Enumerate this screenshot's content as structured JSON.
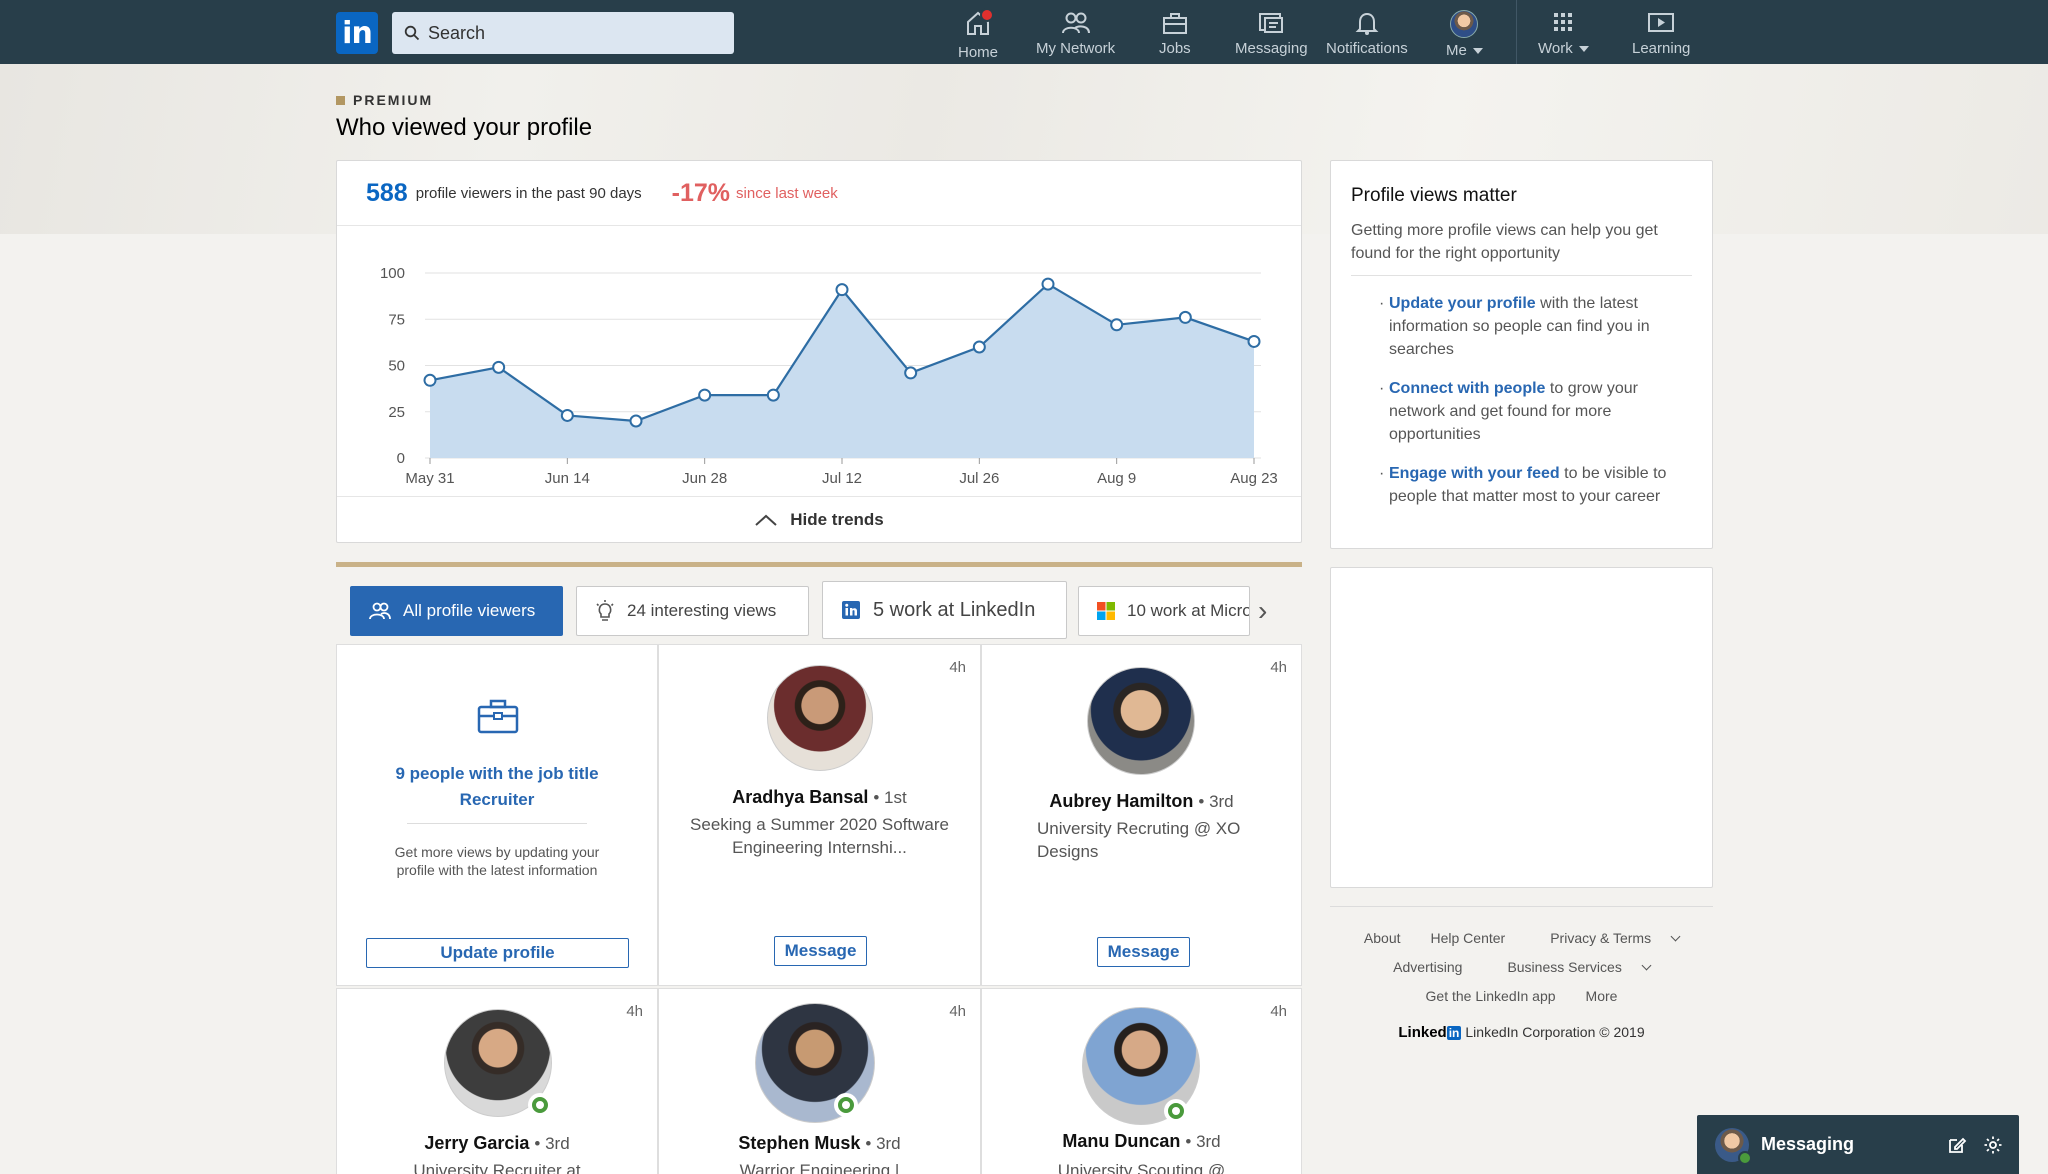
{
  "nav": {
    "logo": "in",
    "search_placeholder": "Search",
    "items": [
      {
        "label": "Home",
        "icon": "home-icon"
      },
      {
        "label": "My Network",
        "icon": "network-icon"
      },
      {
        "label": "Jobs",
        "icon": "briefcase-icon"
      },
      {
        "label": "Messaging",
        "icon": "messaging-icon"
      },
      {
        "label": "Notifications",
        "icon": "bell-icon"
      },
      {
        "label": "Me",
        "icon": "avatar"
      },
      {
        "label": "Work",
        "icon": "grid-icon"
      },
      {
        "label": "Learning",
        "icon": "play-icon"
      }
    ]
  },
  "header": {
    "premium": "PREMIUM",
    "title": "Who viewed your profile"
  },
  "stats": {
    "viewers_count": "588",
    "viewers_text": "profile viewers in the past 90 days",
    "change": "-17%",
    "change_text": "since last week"
  },
  "chart_data": {
    "type": "area",
    "x": [
      "May 31",
      "Jun 7",
      "Jun 14",
      "Jun 21",
      "Jun 28",
      "Jul 5",
      "Jul 12",
      "Jul 19",
      "Jul 26",
      "Aug 2",
      "Aug 9",
      "Aug 16",
      "Aug 23"
    ],
    "values": [
      42,
      49,
      23,
      20,
      34,
      34,
      91,
      46,
      60,
      94,
      72,
      76,
      63
    ],
    "x_tick_labels": [
      "May 31",
      "Jun 14",
      "Jun 28",
      "Jul 12",
      "Jul 26",
      "Aug 9",
      "Aug 23"
    ],
    "y_ticks": [
      0,
      25,
      50,
      75,
      100
    ],
    "ylim": [
      0,
      100
    ],
    "grid": true,
    "color": "#2e6da4",
    "fill": "#c8dcef"
  },
  "trends_label": "Hide trends",
  "tabs": [
    {
      "label": "All profile viewers",
      "icon": "people-icon",
      "active": true
    },
    {
      "label": "24 interesting views",
      "icon": "lightbulb-icon"
    },
    {
      "label": "5 work at LinkedIn",
      "icon": "linkedin-icon"
    },
    {
      "label": "10 work at Micro",
      "icon": "microsoft-icon"
    }
  ],
  "job_card": {
    "title": "9 people with the job title Recruiter",
    "desc": "Get more views by updating your profile with the latest information",
    "button": "Update profile"
  },
  "viewers": [
    {
      "name": "Aradhya Bansal",
      "degree": "• 1st",
      "headline": "Seeking a Summer 2020 Software Engineering Internshi...",
      "time": "4h",
      "button": "Message"
    },
    {
      "name": "Aubrey Hamilton",
      "degree": "• 3rd",
      "headline": "University Recruting @ XO Designs",
      "time": "4h",
      "button": "Message"
    },
    {
      "name": "Jerry Garcia",
      "degree": "• 3rd",
      "headline": "University Recruiter at",
      "time": "4h"
    },
    {
      "name": "Stephen Musk",
      "degree": "• 3rd",
      "headline": "Warrior Engineering |",
      "time": "4h"
    },
    {
      "name": "Manu Duncan",
      "degree": "• 3rd",
      "headline": "University Scouting @",
      "time": "4h"
    }
  ],
  "tips": {
    "title": "Profile views matter",
    "subtitle": "Getting more profile views can help you get found for the right opportunity",
    "items": [
      {
        "link": "Update your profile",
        "text": " with the latest information so people can find you in searches"
      },
      {
        "link": "Connect with people",
        "text": " to grow your network and get found for more opportunities"
      },
      {
        "link": "Engage with your feed",
        "text": " to be visible to people that matter most to your career"
      }
    ]
  },
  "footer": {
    "about": "About",
    "help": "Help Center",
    "privacy": "Privacy & Terms",
    "advertising": "Advertising",
    "business": "Business Services",
    "app": "Get the LinkedIn app",
    "more": "More",
    "brand": "Linked",
    "brand_in": "in",
    "copyright": "LinkedIn Corporation © 2019"
  },
  "messaging": {
    "label": "Messaging"
  }
}
